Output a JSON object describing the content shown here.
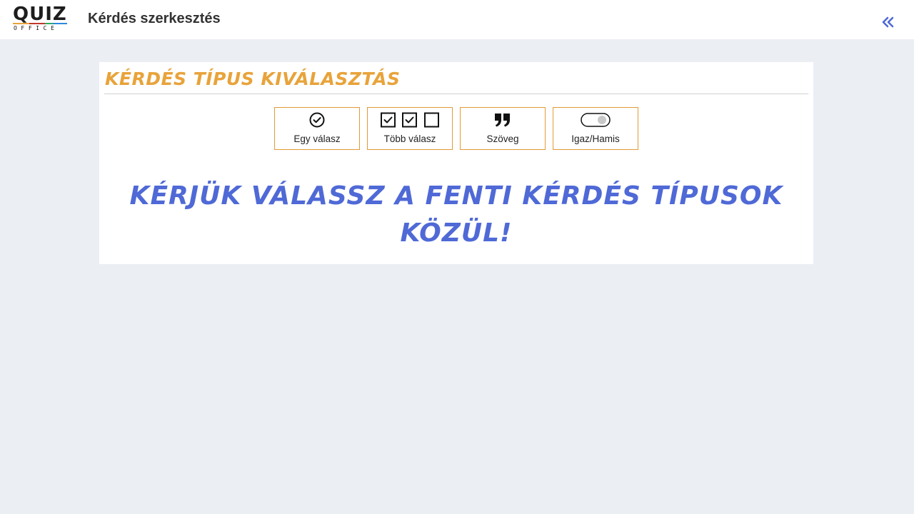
{
  "header": {
    "logo": {
      "main_letters": [
        "Q",
        "U",
        "I",
        "Z"
      ],
      "main_colors": [
        "#1d1d1d",
        "#1d1d1d",
        "#1d1d1d",
        "#1d1d1d"
      ],
      "accent_colors": [
        "#e8a33a",
        "#c0392b",
        "#27ae60",
        "#2e86de"
      ],
      "sub": "OFFICE"
    },
    "title": "Kérdés szerkesztés",
    "collapse_icon": "double-chevron-left-icon"
  },
  "card": {
    "title": "KÉRDÉS TÍPUS KIVÁLASZTÁS",
    "question_types": [
      {
        "label": "Egy válasz",
        "icon": "check-circle-icon"
      },
      {
        "label": "Több válasz",
        "icon": "checkbox-group-icon"
      },
      {
        "label": "Szöveg",
        "icon": "quote-icon"
      },
      {
        "label": "Igaz/Hamis",
        "icon": "toggle-icon"
      }
    ],
    "prompt": "KÉRJÜK VÁLASSZ A FENTI KÉRDÉS TÍPUSOK KÖZÜL!"
  },
  "colors": {
    "background": "#ebeef3",
    "accent_orange": "#e8a33a",
    "accent_blue": "#4f69d6",
    "border_orange": "#e29a36"
  }
}
